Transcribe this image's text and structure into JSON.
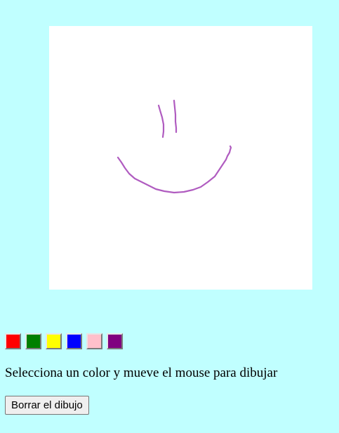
{
  "drawing": {
    "stroke_color": "#b05cc0",
    "strokes": [
      "M156 113 L158 120 L161 130 L163 140 L163 150 L162 158",
      "M178 106 L179 116 L180 126 L180 136 L181 145 L181 151",
      "M98 187 L103 194 L108 202 L114 210 L122 217 L132 222 L142 227 L152 232 L164 235 L178 237 L192 236 L205 233 L216 229 L226 222 L236 214 L242 205 L248 196 L252 190 L254 185 L257 180 L258 176 L259 173 L258 171"
    ]
  },
  "palette": [
    {
      "name": "red",
      "color": "#ff0000"
    },
    {
      "name": "green",
      "color": "#008000"
    },
    {
      "name": "yellow",
      "color": "#ffff00"
    },
    {
      "name": "blue",
      "color": "#0000ff"
    },
    {
      "name": "pink",
      "color": "#ffc0cb"
    },
    {
      "name": "purple",
      "color": "#800080"
    }
  ],
  "instruction_text": "Selecciona un color y mueve el mouse para dibujar",
  "clear_button_label": "Borrar el dibujo"
}
